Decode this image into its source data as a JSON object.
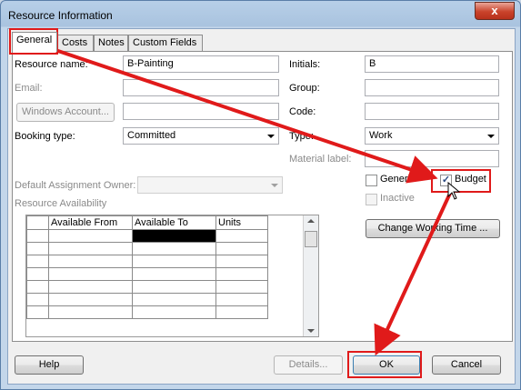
{
  "window": {
    "title": "Resource Information",
    "close_glyph": "x"
  },
  "tabs": [
    {
      "label": "General",
      "active": true
    },
    {
      "label": "Costs"
    },
    {
      "label": "Notes"
    },
    {
      "label": "Custom Fields"
    }
  ],
  "form": {
    "resource_name_label": "Resource name:",
    "resource_name_value": "B-Painting",
    "email_label": "Email:",
    "email_value": "",
    "windows_account_button": "Windows Account...",
    "windows_account_value": "",
    "booking_type_label": "Booking type:",
    "booking_type_value": "Committed",
    "default_owner_label": "Default Assignment Owner:",
    "default_owner_value": "",
    "initials_label": "Initials:",
    "initials_value": "B",
    "group_label": "Group:",
    "group_value": "",
    "code_label": "Code:",
    "code_value": "",
    "type_label": "Type:",
    "type_value": "Work",
    "material_label_label": "Material label:",
    "material_label_value": "",
    "generic_label": "Generic",
    "generic_checked": false,
    "budget_label": "Budget",
    "budget_checked": true,
    "checkmark_glyph": "✓",
    "inactive_label": "Inactive",
    "inactive_checked": false,
    "change_working_time_button": "Change Working Time ..."
  },
  "availability": {
    "title": "Resource Availability",
    "columns": [
      "Available From",
      "Available To",
      "Units"
    ]
  },
  "footer": {
    "help_button": "Help",
    "details_button": "Details...",
    "ok_button": "OK",
    "cancel_button": "Cancel"
  },
  "annotation": {
    "highlight_color": "#e01a1a"
  }
}
